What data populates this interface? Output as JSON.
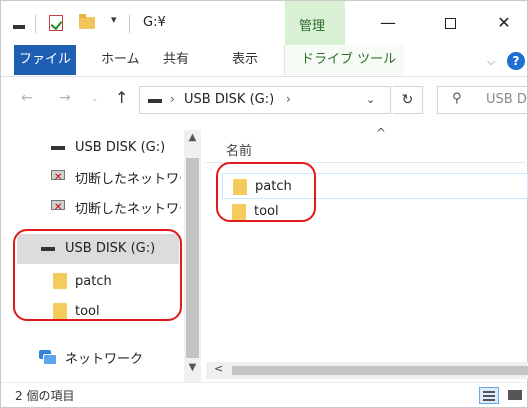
{
  "titlebar": {
    "quick_access_dropdown": "▾",
    "title": "G:¥",
    "contextual_tab": "管理",
    "minimize": "—",
    "close": "✕"
  },
  "ribbon": {
    "tabs": [
      "ファイル",
      "ホーム",
      "共有",
      "表示",
      "ドライブ ツール"
    ],
    "collapse_chevron": "⌵",
    "help": "?"
  },
  "addressbar": {
    "back": "←",
    "forward": "→",
    "history": "⌄",
    "up": "↑",
    "separator": "›",
    "path": "USB DISK (G:)",
    "dropdown": "⌄",
    "refresh": "↻",
    "search_placeholder": "USB D"
  },
  "navpane": {
    "items": [
      {
        "label": "USB DISK (G:)",
        "type": "drive"
      },
      {
        "label": "切断したネットワーク",
        "type": "network-disconnected"
      },
      {
        "label": "切断したネットワーク",
        "type": "network-disconnected"
      },
      {
        "label": "USB DISK (G:)",
        "type": "drive",
        "selected": true
      },
      {
        "label": "patch",
        "type": "folder"
      },
      {
        "label": "tool",
        "type": "folder"
      },
      {
        "label": "ネットワーク",
        "type": "network"
      }
    ],
    "scroll_up": "▲",
    "scroll_down": "▼"
  },
  "content": {
    "sort_indicator": "^",
    "column_name": "名前",
    "files": [
      {
        "name": "patch",
        "type": "folder"
      },
      {
        "name": "tool",
        "type": "folder"
      }
    ],
    "scroll_left": "<"
  },
  "statusbar": {
    "item_count": "2 個の項目"
  },
  "colors": {
    "file_tab": "#1f5fb3",
    "manage_tab": "#d9f0d5",
    "annotation": "#e01a1a",
    "selection": "#dcdcdc"
  }
}
